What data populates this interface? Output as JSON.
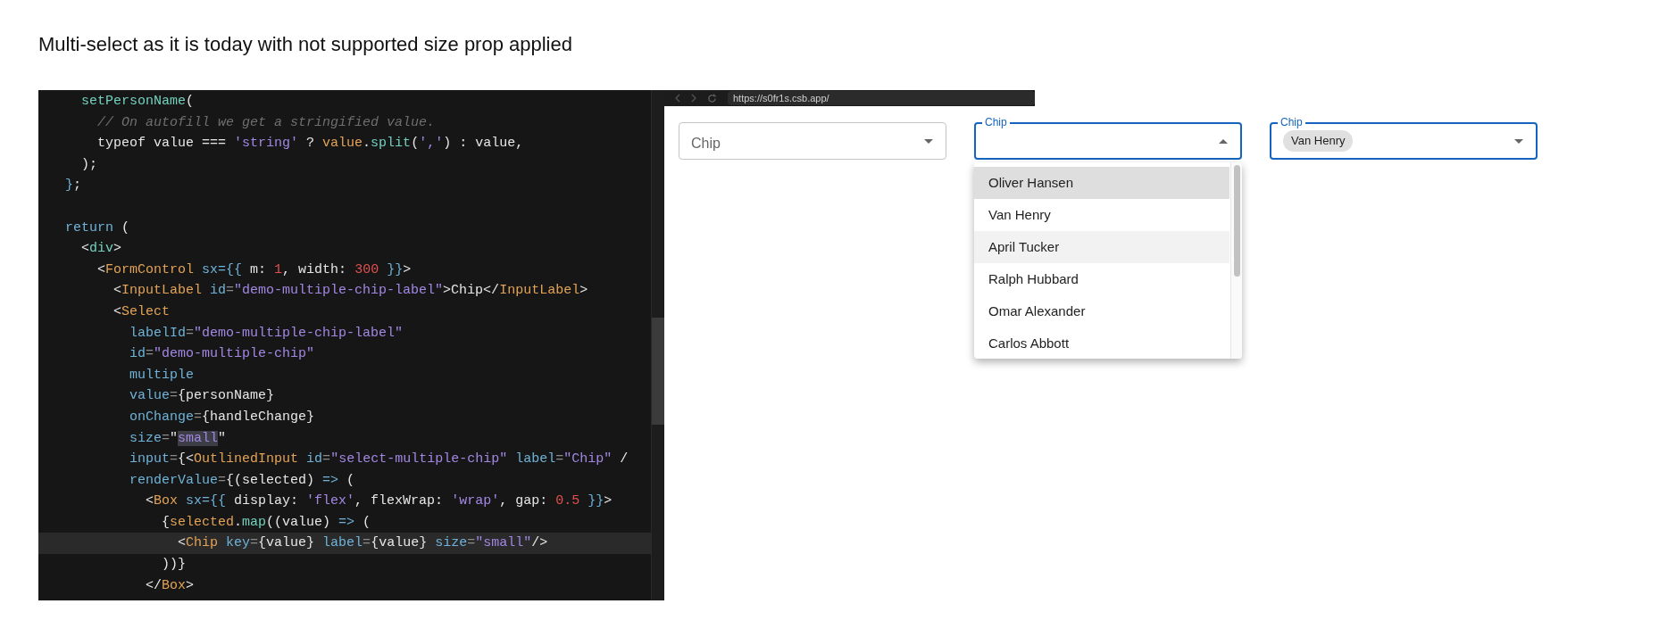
{
  "heading": "Multi-select as it is today with not supported size prop applied",
  "editor": {
    "lines": [
      {
        "current": false,
        "tokens": [
          {
            "kind": "function",
            "text": "    setPersonName"
          },
          {
            "kind": "plain",
            "text": "("
          }
        ]
      },
      {
        "current": false,
        "tokens": [
          {
            "kind": "comment",
            "text": "      // On autofill we get a stringified value."
          }
        ]
      },
      {
        "current": false,
        "tokens": [
          {
            "kind": "plain",
            "text": "      typeof value ==="
          },
          {
            "kind": "string",
            "text": " 'string'"
          },
          {
            "kind": "plain",
            "text": " ?"
          },
          {
            "kind": "tag",
            "text": " value"
          },
          {
            "kind": "plain",
            "text": "."
          },
          {
            "kind": "function",
            "text": "split"
          },
          {
            "kind": "plain",
            "text": "("
          },
          {
            "kind": "string",
            "text": "','"
          },
          {
            "kind": "plain",
            "text": ") : value,"
          }
        ]
      },
      {
        "current": false,
        "tokens": [
          {
            "kind": "plain",
            "text": "    );"
          }
        ]
      },
      {
        "current": false,
        "tokens": [
          {
            "kind": "keyword",
            "text": "  }"
          },
          {
            "kind": "plain",
            "text": ";"
          }
        ]
      },
      {
        "current": false
      },
      {
        "current": false,
        "tokens": [
          {
            "kind": "keyword",
            "text": "  return"
          },
          {
            "kind": "plain",
            "text": " ("
          }
        ]
      },
      {
        "current": false,
        "tokens": [
          {
            "kind": "plain",
            "text": "    <"
          },
          {
            "kind": "function",
            "text": "div"
          },
          {
            "kind": "plain",
            "text": ">"
          }
        ]
      },
      {
        "current": false,
        "tokens": [
          {
            "kind": "plain",
            "text": "      <"
          },
          {
            "kind": "tag",
            "text": "FormControl"
          },
          {
            "kind": "attribute",
            "text": " sx"
          },
          {
            "kind": "keyword",
            "text": "={{"
          },
          {
            "kind": "plain",
            "text": " m:"
          },
          {
            "kind": "number",
            "text": " 1"
          },
          {
            "kind": "plain",
            "text": ", width:"
          },
          {
            "kind": "number",
            "text": " 300"
          },
          {
            "kind": "keyword",
            "text": " }}"
          },
          {
            "kind": "plain",
            "text": ">"
          }
        ]
      },
      {
        "current": false,
        "tokens": [
          {
            "kind": "plain",
            "text": "        <"
          },
          {
            "kind": "tag",
            "text": "InputLabel"
          },
          {
            "kind": "attribute",
            "text": " id"
          },
          {
            "kind": "operator",
            "text": "="
          },
          {
            "kind": "string",
            "text": "\"demo-multiple-chip-label\""
          },
          {
            "kind": "plain",
            "text": ">Chip</"
          },
          {
            "kind": "tag",
            "text": "InputLabel"
          },
          {
            "kind": "plain",
            "text": ">"
          }
        ]
      },
      {
        "current": false,
        "tokens": [
          {
            "kind": "plain",
            "text": "        <"
          },
          {
            "kind": "tag",
            "text": "Select"
          }
        ]
      },
      {
        "current": false,
        "tokens": [
          {
            "kind": "attribute",
            "text": "          labelId"
          },
          {
            "kind": "operator",
            "text": "="
          },
          {
            "kind": "string",
            "text": "\"demo-multiple-chip-label\""
          }
        ]
      },
      {
        "current": false,
        "tokens": [
          {
            "kind": "attribute",
            "text": "          id"
          },
          {
            "kind": "operator",
            "text": "="
          },
          {
            "kind": "string",
            "text": "\"demo-multiple-chip\""
          }
        ]
      },
      {
        "current": false,
        "tokens": [
          {
            "kind": "attribute",
            "text": "          multiple"
          }
        ]
      },
      {
        "current": false,
        "tokens": [
          {
            "kind": "attribute",
            "text": "          value"
          },
          {
            "kind": "operator",
            "text": "="
          },
          {
            "kind": "plain",
            "text": "{personName}"
          }
        ]
      },
      {
        "current": false,
        "tokens": [
          {
            "kind": "attribute",
            "text": "          onChange"
          },
          {
            "kind": "operator",
            "text": "="
          },
          {
            "kind": "plain",
            "text": "{handleChange}"
          }
        ]
      },
      {
        "current": false,
        "tokens": [
          {
            "kind": "attribute",
            "text": "          size"
          },
          {
            "kind": "operator",
            "text": "="
          },
          {
            "kind": "plain",
            "text": "\""
          },
          {
            "kind": "match",
            "text": "small"
          },
          {
            "kind": "plain",
            "text": "\""
          }
        ]
      },
      {
        "current": false,
        "tokens": [
          {
            "kind": "attribute",
            "text": "          input"
          },
          {
            "kind": "operator",
            "text": "="
          },
          {
            "kind": "plain",
            "text": "{<"
          },
          {
            "kind": "tag",
            "text": "OutlinedInput"
          },
          {
            "kind": "attribute",
            "text": " id"
          },
          {
            "kind": "operator",
            "text": "="
          },
          {
            "kind": "string",
            "text": "\"select-multiple-chip\""
          },
          {
            "kind": "attribute",
            "text": " label"
          },
          {
            "kind": "operator",
            "text": "="
          },
          {
            "kind": "string",
            "text": "\"Chip\""
          },
          {
            "kind": "plain",
            "text": " /"
          }
        ]
      },
      {
        "current": false,
        "tokens": [
          {
            "kind": "attribute",
            "text": "          renderValue"
          },
          {
            "kind": "operator",
            "text": "="
          },
          {
            "kind": "plain",
            "text": "{(selected)"
          },
          {
            "kind": "keyword",
            "text": " =>"
          },
          {
            "kind": "plain",
            "text": " ("
          }
        ]
      },
      {
        "current": false,
        "tokens": [
          {
            "kind": "plain",
            "text": "            <"
          },
          {
            "kind": "tag",
            "text": "Box"
          },
          {
            "kind": "attribute",
            "text": " sx"
          },
          {
            "kind": "keyword",
            "text": "={{"
          },
          {
            "kind": "plain",
            "text": " display:"
          },
          {
            "kind": "string",
            "text": " 'flex'"
          },
          {
            "kind": "plain",
            "text": ", flexWrap:"
          },
          {
            "kind": "string",
            "text": " 'wrap'"
          },
          {
            "kind": "plain",
            "text": ", gap:"
          },
          {
            "kind": "number",
            "text": " 0.5"
          },
          {
            "kind": "keyword",
            "text": " }}"
          },
          {
            "kind": "plain",
            "text": ">"
          }
        ]
      },
      {
        "current": false,
        "tokens": [
          {
            "kind": "plain",
            "text": "              {"
          },
          {
            "kind": "tag",
            "text": "selected"
          },
          {
            "kind": "plain",
            "text": "."
          },
          {
            "kind": "function",
            "text": "map"
          },
          {
            "kind": "plain",
            "text": "((value)"
          },
          {
            "kind": "keyword",
            "text": " =>"
          },
          {
            "kind": "plain",
            "text": " ("
          }
        ]
      },
      {
        "current": true,
        "tokens": [
          {
            "kind": "plain",
            "text": "                <"
          },
          {
            "kind": "tag",
            "text": "Chip"
          },
          {
            "kind": "attribute",
            "text": " key"
          },
          {
            "kind": "operator",
            "text": "="
          },
          {
            "kind": "plain",
            "text": "{value}"
          },
          {
            "kind": "attribute",
            "text": " label"
          },
          {
            "kind": "operator",
            "text": "="
          },
          {
            "kind": "plain",
            "text": "{value}"
          },
          {
            "kind": "attribute",
            "text": " size"
          },
          {
            "kind": "operator",
            "text": "="
          },
          {
            "kind": "string",
            "text": "\"small\""
          },
          {
            "kind": "plain",
            "text": "/>"
          }
        ]
      },
      {
        "current": false,
        "tokens": [
          {
            "kind": "plain",
            "text": "              ))}"
          }
        ]
      },
      {
        "current": false,
        "tokens": [
          {
            "kind": "plain",
            "text": "            </"
          },
          {
            "kind": "tag",
            "text": "Box"
          },
          {
            "kind": "plain",
            "text": ">"
          }
        ]
      }
    ]
  },
  "browser": {
    "url": "https://s0fr1s.csb.app/",
    "selects": [
      {
        "label": "Chip",
        "focused": false,
        "open": false
      },
      {
        "label": "Chip",
        "focused": true,
        "open": true,
        "menu": [
          {
            "text": "Oliver Hansen",
            "focused": true,
            "hovered": false
          },
          {
            "text": "Van Henry",
            "focused": false,
            "hovered": false
          },
          {
            "text": "April Tucker",
            "focused": false,
            "hovered": true
          },
          {
            "text": "Ralph Hubbard",
            "focused": false,
            "hovered": false
          },
          {
            "text": "Omar Alexander",
            "focused": false,
            "hovered": false
          },
          {
            "text": "Carlos Abbott",
            "focused": false,
            "hovered": false
          }
        ]
      },
      {
        "label": "Chip",
        "focused": true,
        "open": false,
        "chips": [
          "Van Henry"
        ]
      }
    ]
  }
}
